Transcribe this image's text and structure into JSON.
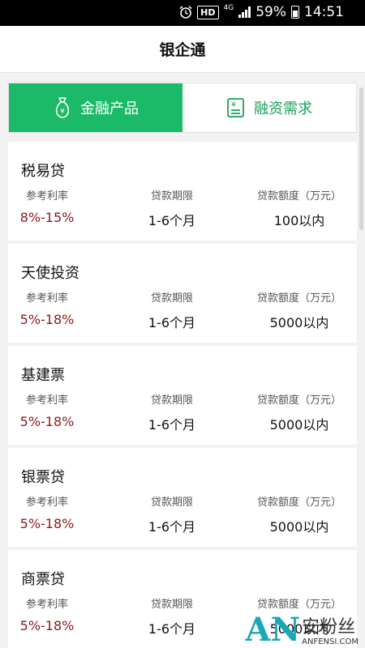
{
  "statusbar": {
    "hd": "HD",
    "network": "4G",
    "battery": "59%",
    "time": "14:51"
  },
  "header": {
    "title": "银企通"
  },
  "tabs": [
    {
      "label": "金融产品",
      "icon": "money-bag-icon",
      "active": true
    },
    {
      "label": "融资需求",
      "icon": "document-yuan-icon",
      "active": false
    }
  ],
  "columns": {
    "rate": "参考利率",
    "term": "贷款期限",
    "amount": "贷款额度（万元）"
  },
  "products": [
    {
      "name": "税易贷",
      "rate": "8%-15%",
      "term": "1-6个月",
      "amount": "100以内"
    },
    {
      "name": "天使投资",
      "rate": "5%-18%",
      "term": "1-6个月",
      "amount": "5000以内"
    },
    {
      "name": "基建票",
      "rate": "5%-18%",
      "term": "1-6个月",
      "amount": "5000以内"
    },
    {
      "name": "银票贷",
      "rate": "5%-18%",
      "term": "1-6个月",
      "amount": "5000以内"
    },
    {
      "name": "商票贷",
      "rate": "5%-18%",
      "term": "1-6个月",
      "amount": "5000以内"
    }
  ],
  "watermark": {
    "logo": "AN",
    "cn": "安粉丝",
    "en": "ANFENSI.COM"
  },
  "colors": {
    "accent": "#1aba68",
    "rate": "#8b1a1a"
  }
}
